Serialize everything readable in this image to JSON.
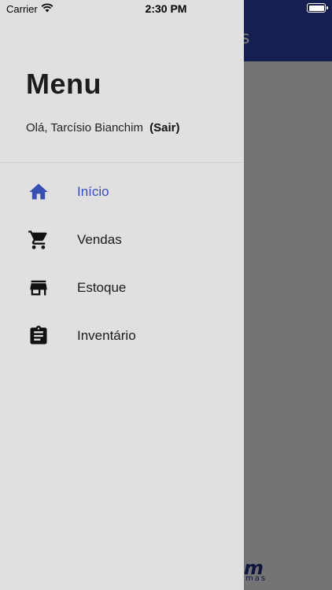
{
  "status_bar": {
    "carrier": "Carrier",
    "time": "2:30 PM"
  },
  "drawer": {
    "title": "Menu",
    "greeting_prefix": "Olá,",
    "user_name": "Tarcísio Bianchim",
    "logout_label": "(Sair)",
    "items": [
      {
        "label": "Início",
        "icon": "home-icon",
        "active": true
      },
      {
        "label": "Vendas",
        "icon": "cart-icon",
        "active": false
      },
      {
        "label": "Estoque",
        "icon": "store-icon",
        "active": false
      },
      {
        "label": "Inventário",
        "icon": "clipboard-icon",
        "active": false
      }
    ]
  },
  "background_app": {
    "header_title_fragment": "s",
    "logo_fragment": "m",
    "logo_sub_fragment": "mas"
  },
  "colors": {
    "header": "#2e3fa0",
    "active_item": "#3a4fb3",
    "drawer_bg": "#e0e0e0"
  }
}
